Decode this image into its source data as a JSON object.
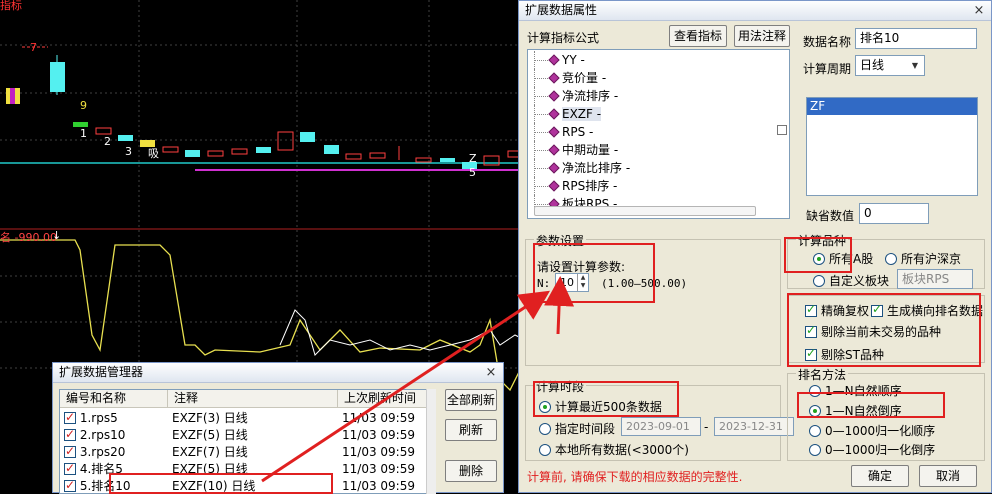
{
  "chart": {
    "top_label": "指标",
    "bar_labels": [
      "7",
      "9",
      "1",
      "2",
      "3",
      "吸",
      "Z",
      "5"
    ],
    "indicator_label": "名 -990.00",
    "indicator_arrow": "↓"
  },
  "props_dialog": {
    "title": "扩展数据属性",
    "close": "×",
    "formula_label": "计算指标公式",
    "view_btn": "查看指标",
    "usage_btn": "用法注释",
    "tree_items": [
      "YY -",
      "竞价量 -",
      "净流排序 -",
      "EXZF -",
      "RPS -",
      "中期动量 -",
      "净流比排序 -",
      "RPS排序 -",
      "板块RPS -"
    ],
    "selected_item": "EXZF -",
    "data_name_label": "数据名称",
    "data_name_value": "排名10",
    "period_label": "计算周期",
    "period_value": "日线",
    "list_item": "ZF",
    "missing_label": "缺省数值",
    "missing_value": "0",
    "params_group": "参数设置",
    "params_prompt": "请设置计算参数:",
    "param_n_label": "N:",
    "param_n_value": "10",
    "param_range": "(1.00–500.00)",
    "variety_group": "计算品种",
    "variety_opts": [
      "所有A股",
      "所有沪深京",
      "自定义板块"
    ],
    "sector_value": "板块RPS",
    "checks": [
      "精确复权",
      "生成横向排名数据",
      "剔除当前未交易的品种",
      "剔除ST品种"
    ],
    "period_group": "计算时段",
    "period_opts": [
      "计算最近500条数据",
      "指定时间段",
      "本地所有数据(<3000个)"
    ],
    "date_from": "2023-09-01",
    "date_sep": "-",
    "date_to": "2023-12-31",
    "sort_group": "排名方法",
    "sort_opts": [
      "1—N自然顺序",
      "1—N自然倒序",
      "0—1000归一化顺序",
      "0—1000归一化倒序"
    ],
    "warning": "计算前, 请确保下载的相应数据的完整性.",
    "ok_btn": "确定",
    "cancel_btn": "取消"
  },
  "manager_dialog": {
    "title": "扩展数据管理器",
    "close": "×",
    "headers": [
      "编号和名称",
      "注释",
      "上次刷新时间"
    ],
    "rows": [
      {
        "name": "1.rps5",
        "note": "EXZF(3) 日线",
        "time": "11/03 09:59"
      },
      {
        "name": "2.rps10",
        "note": "EXZF(5) 日线",
        "time": "11/03 09:59"
      },
      {
        "name": "3.rps20",
        "note": "EXZF(7) 日线",
        "time": "11/03 09:59"
      },
      {
        "name": "4.排名5",
        "note": "EXZF(5) 日线",
        "time": "11/03 09:59"
      },
      {
        "name": "5.排名10",
        "note": "EXZF(10) 日线",
        "time": "11/03 09:59"
      }
    ],
    "refresh_all_btn": "全部刷新",
    "refresh_btn": "刷新",
    "delete_btn": "删除"
  },
  "colors": {
    "accent_red": "#e02020",
    "tree_diamond": "#b0339c"
  }
}
